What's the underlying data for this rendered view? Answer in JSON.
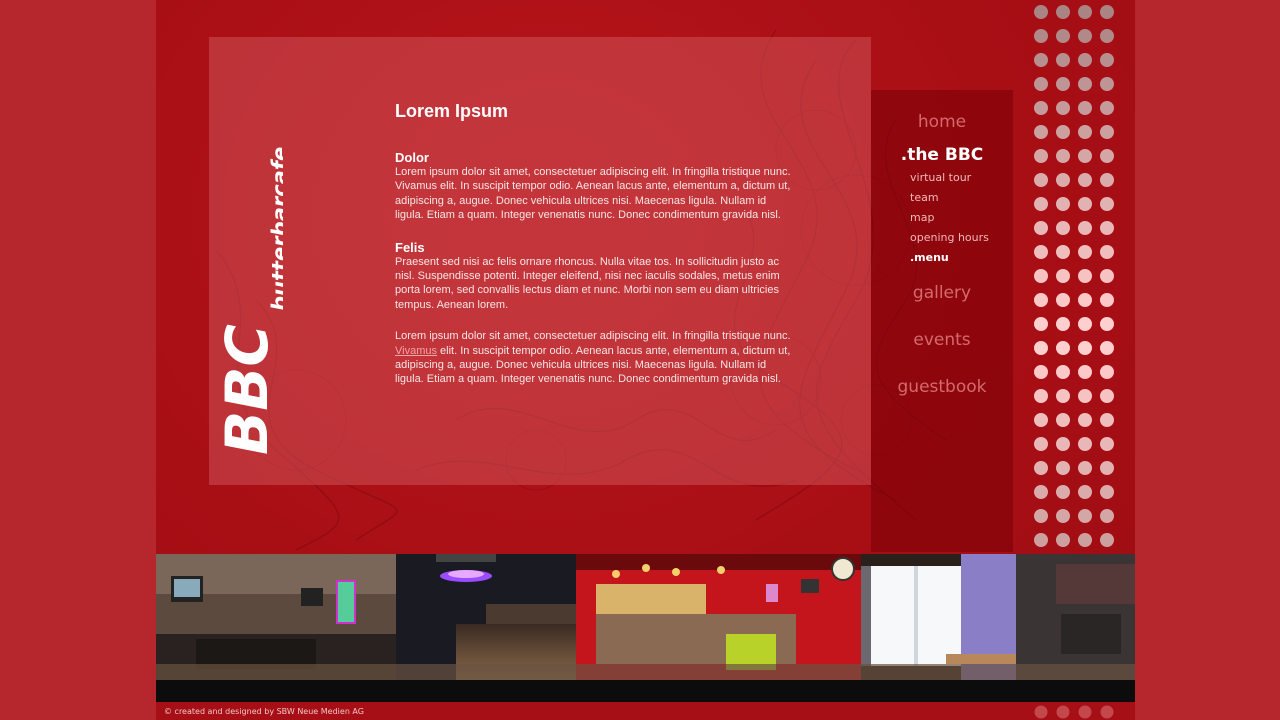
{
  "brand": {
    "logo_big": "BBC",
    "logo_small": "butterbarcafe"
  },
  "article": {
    "title": "Lorem Ipsum",
    "sections": [
      {
        "heading": "Dolor",
        "text": "Lorem ipsum dolor sit amet, consectetuer adipiscing elit. In fringilla tristique nunc. Vivamus elit. In suscipit tempor odio. Aenean lacus ante, elementum a, dictum ut, adipiscing a, augue. Donec vehicula ultrices nisi. Maecenas ligula. Nullam id ligula. Etiam a quam. Integer venenatis nunc. Donec condimentum gravida nisl."
      },
      {
        "heading": "Felis",
        "text": "Praesent sed nisi ac felis ornare rhoncus. Nulla vitae tos. In sollicitudin justo ac nisl. Suspendisse potenti. Integer eleifend, nisi nec iaculis sodales, metus enim porta lorem, sed convallis lectus diam et nunc. Morbi non sem eu diam ultricies tempus. Aenean lorem."
      }
    ],
    "last_paragraph": {
      "before_link": "Lorem ipsum dolor sit amet, consectetuer adipiscing elit. In fringilla tristique nunc. ",
      "link": "Vivamus",
      "after_link": " elit. In suscipit tempor odio. Aenean lacus ante, elementum a, dictum ut, adipiscing a, augue. Donec vehicula ultrices nisi. Maecenas ligula. Nullam id ligula. Etiam a quam. Integer venenatis nunc. Donec condimentum gravida nisl."
    }
  },
  "nav": {
    "home": "home",
    "the_bbc": ".the BBC",
    "sub": [
      "virtual tour",
      "team",
      "map",
      "opening hours",
      ".menu"
    ],
    "gallery": "gallery",
    "events": "events",
    "guestbook": "guestbook"
  },
  "footer": {
    "credit": "© created and designed by SBW Neue Medien AG"
  },
  "colors": {
    "background": "#b5272d",
    "page": "#a80f15",
    "nav_inactive": "#d46a6e",
    "nav_active": "#ffffff"
  }
}
